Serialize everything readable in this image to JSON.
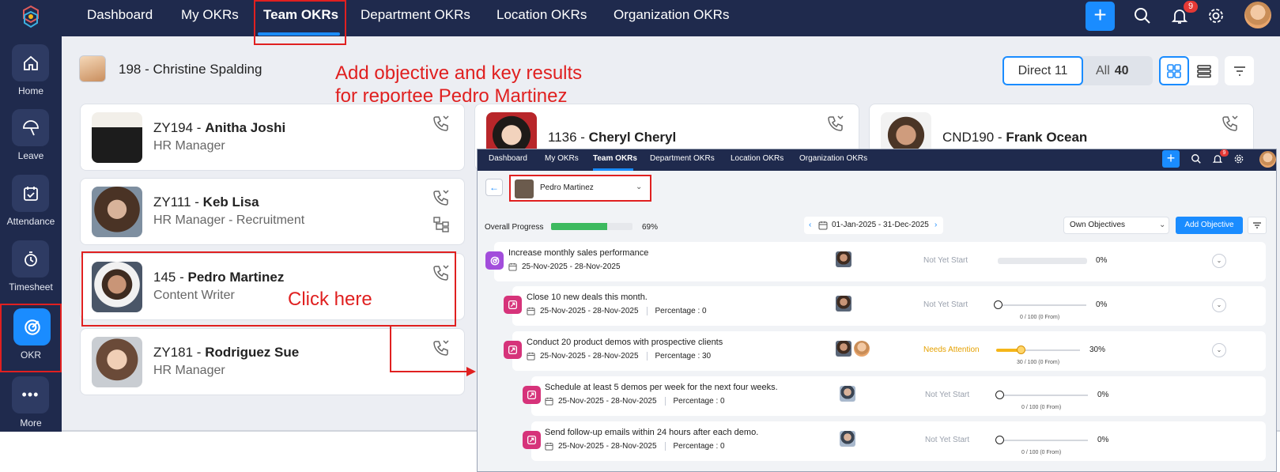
{
  "main_nav": {
    "tabs": [
      "Dashboard",
      "My OKRs",
      "Team OKRs",
      "Department OKRs",
      "Location OKRs",
      "Organization OKRs"
    ],
    "active_tab": "Team OKRs",
    "notification_count": "9"
  },
  "sidebar": {
    "items": [
      {
        "label": "Home",
        "icon": "home-icon"
      },
      {
        "label": "Leave",
        "icon": "leave-icon"
      },
      {
        "label": "Attendance",
        "icon": "attendance-icon"
      },
      {
        "label": "Timesheet",
        "icon": "timesheet-icon"
      },
      {
        "label": "OKR",
        "icon": "okr-target-icon",
        "active": true
      },
      {
        "label": "More",
        "icon": "more-icon"
      }
    ]
  },
  "manager": {
    "id": "198 - ",
    "name": "Christine Spalding"
  },
  "annotations": {
    "instruction_line1": "Add objective and key results",
    "instruction_line2": "for reportee Pedro Martinez",
    "click_here": "Click here"
  },
  "filters": {
    "direct_label": "Direct",
    "direct_count": "11",
    "all_label": "All",
    "all_count": "40"
  },
  "employees": [
    {
      "id": "ZY194 - ",
      "name": "Anitha Joshi",
      "role": "HR Manager"
    },
    {
      "id": "ZY111 - ",
      "name": "Keb Lisa",
      "role": "HR Manager - Recruitment"
    },
    {
      "id": "145 - ",
      "name": "Pedro Martinez",
      "role": "Content Writer"
    },
    {
      "id": "ZY181 - ",
      "name": "Rodriguez Sue",
      "role": "HR Manager"
    },
    {
      "id": "1136 - ",
      "name": "Cheryl Cheryl",
      "role": ""
    },
    {
      "id": "CND190 - ",
      "name": "Frank Ocean",
      "role": ""
    }
  ],
  "inset": {
    "nav_tabs": [
      "Dashboard",
      "My OKRs",
      "Team OKRs",
      "Department OKRs",
      "Location OKRs",
      "Organization OKRs"
    ],
    "notification_count": "9",
    "selected_employee": "Pedro Martinez",
    "overall_progress_label": "Overall Progress",
    "overall_progress_value": 69,
    "overall_progress_text": "69%",
    "date_range": "01-Jan-2025 - 31-Dec-2025",
    "objective_filter": "Own Objectives",
    "add_objective_label": "Add Objective",
    "objectives": [
      {
        "title": "Increase monthly sales performance",
        "dates": "25-Nov-2025 - 28-Nov-2025",
        "percentage": "",
        "status": "Not Yet Start",
        "progress": 0,
        "pct_text": "0%",
        "from_text": ""
      },
      {
        "title": "Close 10 new deals this month.",
        "dates": "25-Nov-2025 - 28-Nov-2025",
        "percentage": "Percentage : 0",
        "status": "Not Yet Start",
        "progress": 0,
        "pct_text": "0%",
        "from_text": "0 / 100 (0 From)"
      },
      {
        "title": "Conduct 20 product demos with prospective clients",
        "dates": "25-Nov-2025 - 28-Nov-2025",
        "percentage": "Percentage : 30",
        "status": "Needs Attention",
        "progress": 30,
        "pct_text": "30%",
        "from_text": "30 / 100 (0 From)"
      },
      {
        "title": "Schedule at least 5 demos per week for the next four weeks.",
        "dates": "25-Nov-2025 - 28-Nov-2025",
        "percentage": "Percentage : 0",
        "status": "Not Yet Start",
        "progress": 0,
        "pct_text": "0%",
        "from_text": "0 / 100 (0 From)"
      },
      {
        "title": "Send follow-up emails within 24 hours after each demo.",
        "dates": "25-Nov-2025 - 28-Nov-2025",
        "percentage": "Percentage : 0",
        "status": "Not Yet Start",
        "progress": 0,
        "pct_text": "0%",
        "from_text": "0 / 100 (0 From)"
      }
    ]
  },
  "colors": {
    "nav_bg": "#1f2a4d",
    "accent": "#1a8cff",
    "annotation": "#e02020",
    "progress_green": "#3dba5f",
    "warn": "#f5b619",
    "kr_icon": "#d6337a",
    "objective_icon": "#a24ddb"
  }
}
